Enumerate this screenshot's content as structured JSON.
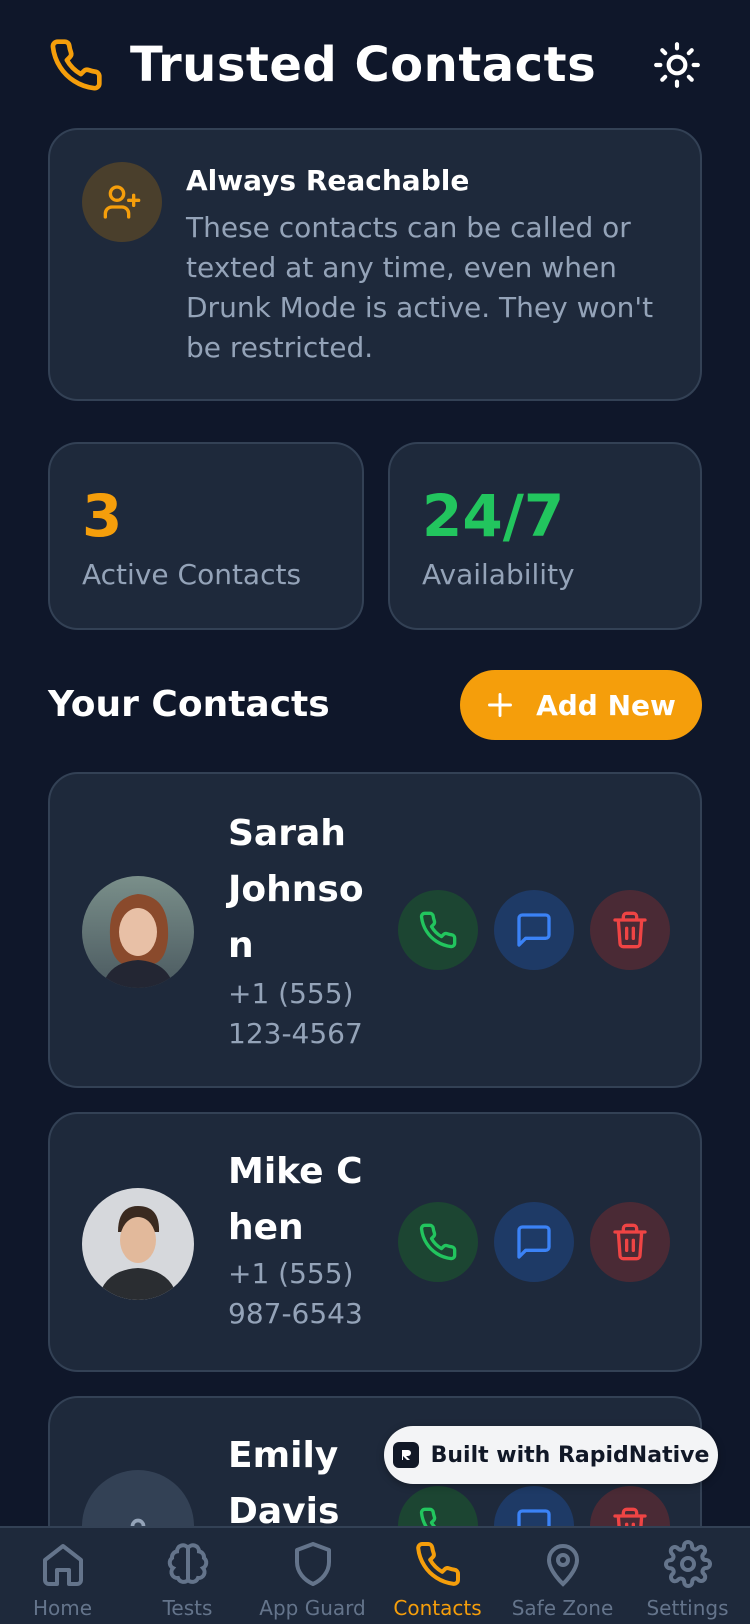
{
  "header": {
    "title": "Trusted Contacts"
  },
  "info": {
    "title": "Always Reachable",
    "text": "These contacts can be called or texted at any time, even when Drunk Mode is active. They won't be restricted."
  },
  "stats": [
    {
      "value": "3",
      "label": "Active Contacts",
      "color": "#f59e0b"
    },
    {
      "value": "24/7",
      "label": "Availability",
      "color": "#22c55e"
    }
  ],
  "section": {
    "title": "Your Contacts",
    "add_label": "Add New"
  },
  "contacts": [
    {
      "name": "Sarah Johnson",
      "phone": "+1 (555) 123-4567"
    },
    {
      "name": "Mike Chen",
      "phone": "+1 (555) 987-6543"
    },
    {
      "name": "Emily Davis",
      "phone": ""
    }
  ],
  "badge": {
    "label": "Built with RapidNative"
  },
  "tabs": [
    {
      "label": "Home",
      "icon": "home-icon"
    },
    {
      "label": "Tests",
      "icon": "brain-icon"
    },
    {
      "label": "App Guard",
      "icon": "shield-icon"
    },
    {
      "label": "Contacts",
      "icon": "phone-icon",
      "active": true
    },
    {
      "label": "Safe Zone",
      "icon": "map-pin-icon"
    },
    {
      "label": "Settings",
      "icon": "gear-icon"
    }
  ],
  "colors": {
    "accent": "#f59e0b",
    "green": "#22c55e",
    "blue": "#3b82f6",
    "red": "#ef4444"
  }
}
